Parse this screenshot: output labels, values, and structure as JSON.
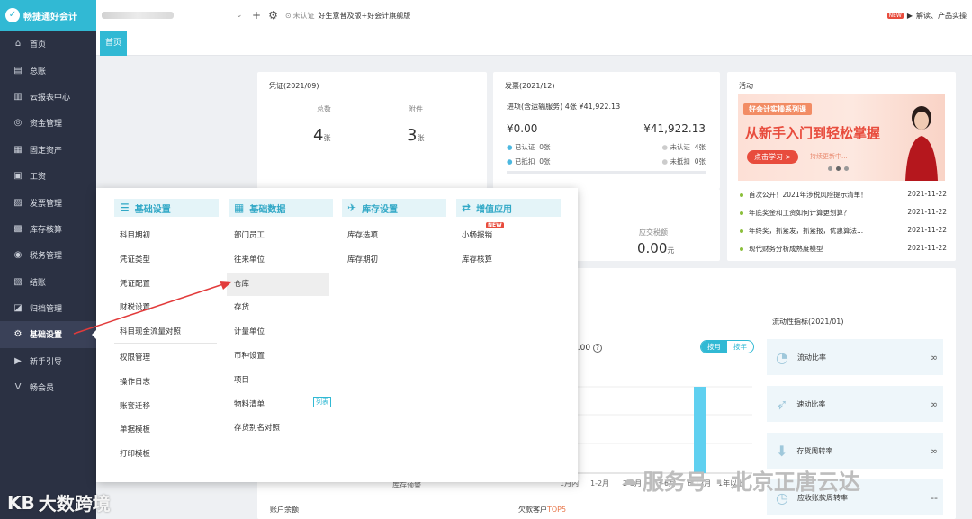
{
  "app": {
    "logo_text": "畅捷通好会计"
  },
  "sidebar": {
    "items": [
      {
        "label": "首页",
        "icon": "home-icon",
        "glyph": "⌂"
      },
      {
        "label": "总账",
        "icon": "ledger-icon",
        "glyph": "▤"
      },
      {
        "label": "云报表中心",
        "icon": "chart-icon",
        "glyph": "▥"
      },
      {
        "label": "资金管理",
        "icon": "money-icon",
        "glyph": "◎"
      },
      {
        "label": "固定资产",
        "icon": "asset-icon",
        "glyph": "▦"
      },
      {
        "label": "工资",
        "icon": "salary-icon",
        "glyph": "▣"
      },
      {
        "label": "发票管理",
        "icon": "invoice-icon",
        "glyph": "▨"
      },
      {
        "label": "库存核算",
        "icon": "inventory-icon",
        "glyph": "▩"
      },
      {
        "label": "税务管理",
        "icon": "tax-icon",
        "glyph": "◉"
      },
      {
        "label": "结账",
        "icon": "close-books-icon",
        "glyph": "▧"
      },
      {
        "label": "归档管理",
        "icon": "archive-icon",
        "glyph": "◪"
      },
      {
        "label": "基础设置",
        "icon": "gear-icon",
        "glyph": "⚙"
      },
      {
        "label": "新手引导",
        "icon": "guide-icon",
        "glyph": "▶"
      },
      {
        "label": "畅会员",
        "icon": "vip-icon",
        "glyph": "V"
      }
    ]
  },
  "topbar": {
    "cert_text": "未认证",
    "promo_text": "好生意普及版+好会计旗舰版",
    "new_badge": "NEW",
    "right_text": "解读、产品实操"
  },
  "tabs": {
    "home": "首页"
  },
  "voucher": {
    "title": "凭证(2021/09)",
    "total_label": "总数",
    "total": "4",
    "attach_label": "附件",
    "attach": "3",
    "unit": "张"
  },
  "invoice": {
    "title": "发票(2021/12)",
    "sub": "进项(含运输服务) 4张 ¥41,922.13",
    "amount_left": "¥0.00",
    "amount_right": "¥41,922.13",
    "r1l": "已认证",
    "r1lv": "0张",
    "r1r": "未认证",
    "r1rv": "4张",
    "r2l": "已抵扣",
    "r2lv": "0张",
    "r2r": "未抵扣",
    "r2rv": "0张"
  },
  "tax": {
    "label": "应交税额",
    "value": "0.00",
    "unit": "元"
  },
  "activity": {
    "title": "活动",
    "banner_tag": "好会计实操系列课",
    "banner_title": "从新手入门到轻松掌握",
    "banner_btn": "点击学习 >",
    "banner_note": "持续更新中...",
    "news": [
      {
        "text": "首次公开！2021年涉税风险提示清单！",
        "date": "2021-11-22"
      },
      {
        "text": "年底奖金和工资如何计算更划算？",
        "date": "2021-11-22"
      },
      {
        "text": "年终奖，抓紧发，抓紧报，优惠算法...",
        "date": "2021-11-22"
      },
      {
        "text": "现代财务分析成熟度模型",
        "date": "2021-11-22"
      }
    ]
  },
  "panel": {
    "amount": "0.00",
    "toggle_month": "按月",
    "toggle_year": "按年",
    "liquidity_title": "流动性指标(2021/01)",
    "liquidity": [
      {
        "label": "流动比率",
        "value": "∞"
      },
      {
        "label": "速动比率",
        "value": "∞"
      },
      {
        "label": "存货周转率",
        "value": "∞"
      },
      {
        "label": "应收账款周转率",
        "value": "--"
      }
    ],
    "xticks": [
      "1月内",
      "1-2月",
      "2-3月",
      "3-6月",
      "6-12月",
      "1年以上"
    ],
    "footer_left": "账户余额",
    "footer_mid": "库存预警",
    "footer_debt": "欠款客户",
    "footer_top": "TOP5"
  },
  "menu": {
    "columns": [
      {
        "title": "基础设置",
        "items": [
          "科目期初",
          "凭证类型",
          "凭证配置",
          "财税设置",
          "科目现金流量对照",
          "权限管理",
          "操作日志",
          "账套迁移",
          "单据模板",
          "打印模板"
        ]
      },
      {
        "title": "基础数据",
        "items": [
          "部门员工",
          "往来单位",
          "仓库",
          "存货",
          "计量单位",
          "币种设置",
          "项目",
          "物料清单",
          "存货别名对照"
        ]
      },
      {
        "title": "库存设置",
        "items": [
          "库存选项",
          "库存期初"
        ]
      },
      {
        "title": "增值应用",
        "items": [
          "小畅报销",
          "库存核算"
        ]
      }
    ],
    "tag_list": "列表",
    "tag_new": "NEW"
  },
  "watermark": {
    "left": "大数跨境",
    "right": "服务号 · 北京正唐云达"
  }
}
